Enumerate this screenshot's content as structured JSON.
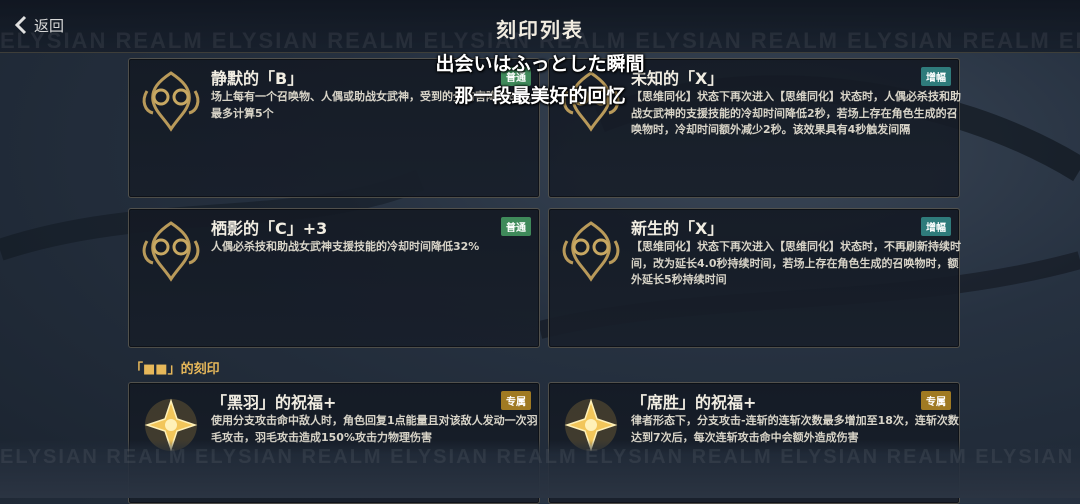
{
  "header": {
    "back_label": "返回",
    "title": "刻印列表",
    "bg_text": "ELYSIAN REALM ELYSIAN REALM ELYSIAN REALM ELYSIAN REALM ELYSIAN REALM ELYSIAN REALM ELYSIAN REALM"
  },
  "subtitles": {
    "line1": "出会いはふっとした瞬間",
    "line2": "那一段最美好的回忆"
  },
  "cards": [
    {
      "name": "静默的「B」",
      "badge": "普通",
      "desc": "场上每有一个召唤物、人偶或助战女武神，受到的全伤害降低8%，最多计算5个"
    },
    {
      "name": "未知的「X」",
      "badge": "增幅",
      "desc": "【思维同化】状态下再次进入【思维同化】状态时，人偶必杀技和助战女武神的支援技能的冷却时间降低2秒，若场上存在角色生成的召唤物时，冷却时间额外减少2秒。该效果具有4秒触发间隔"
    },
    {
      "name": "栖影的「C」+3",
      "badge": "普通",
      "desc": "人偶必杀技和助战女武神支援技能的冷却时间降低32%"
    },
    {
      "name": "新生的「X」",
      "badge": "增幅",
      "desc": "【思维同化】状态下再次进入【思维同化】状态时，不再刷新持续时间，改为延长4.0秒持续时间，若场上存在角色生成的召唤物时，额外延长5秒持续时间"
    },
    {
      "name": "「黑羽」的祝福+",
      "badge": "专属",
      "desc": "使用分支攻击命中敌人时，角色回复1点能量且对该敌人发动一次羽毛攻击，羽毛攻击造成150%攻击力物理伤害"
    },
    {
      "name": "「席胜」的祝福+",
      "badge": "专属",
      "desc": "律者形态下，分支攻击-连斩的连斩次数最多增加至18次，连斩次数达到7次后，每次连斩攻击命中会额外造成伤害"
    }
  ],
  "section": {
    "label": "「■■」的刻印"
  },
  "colors": {
    "accent_gold": "#e7b85a",
    "badge_common": "#3f8a5a",
    "badge_boost": "#2f7b7b",
    "badge_exclusive": "#a07a22"
  }
}
